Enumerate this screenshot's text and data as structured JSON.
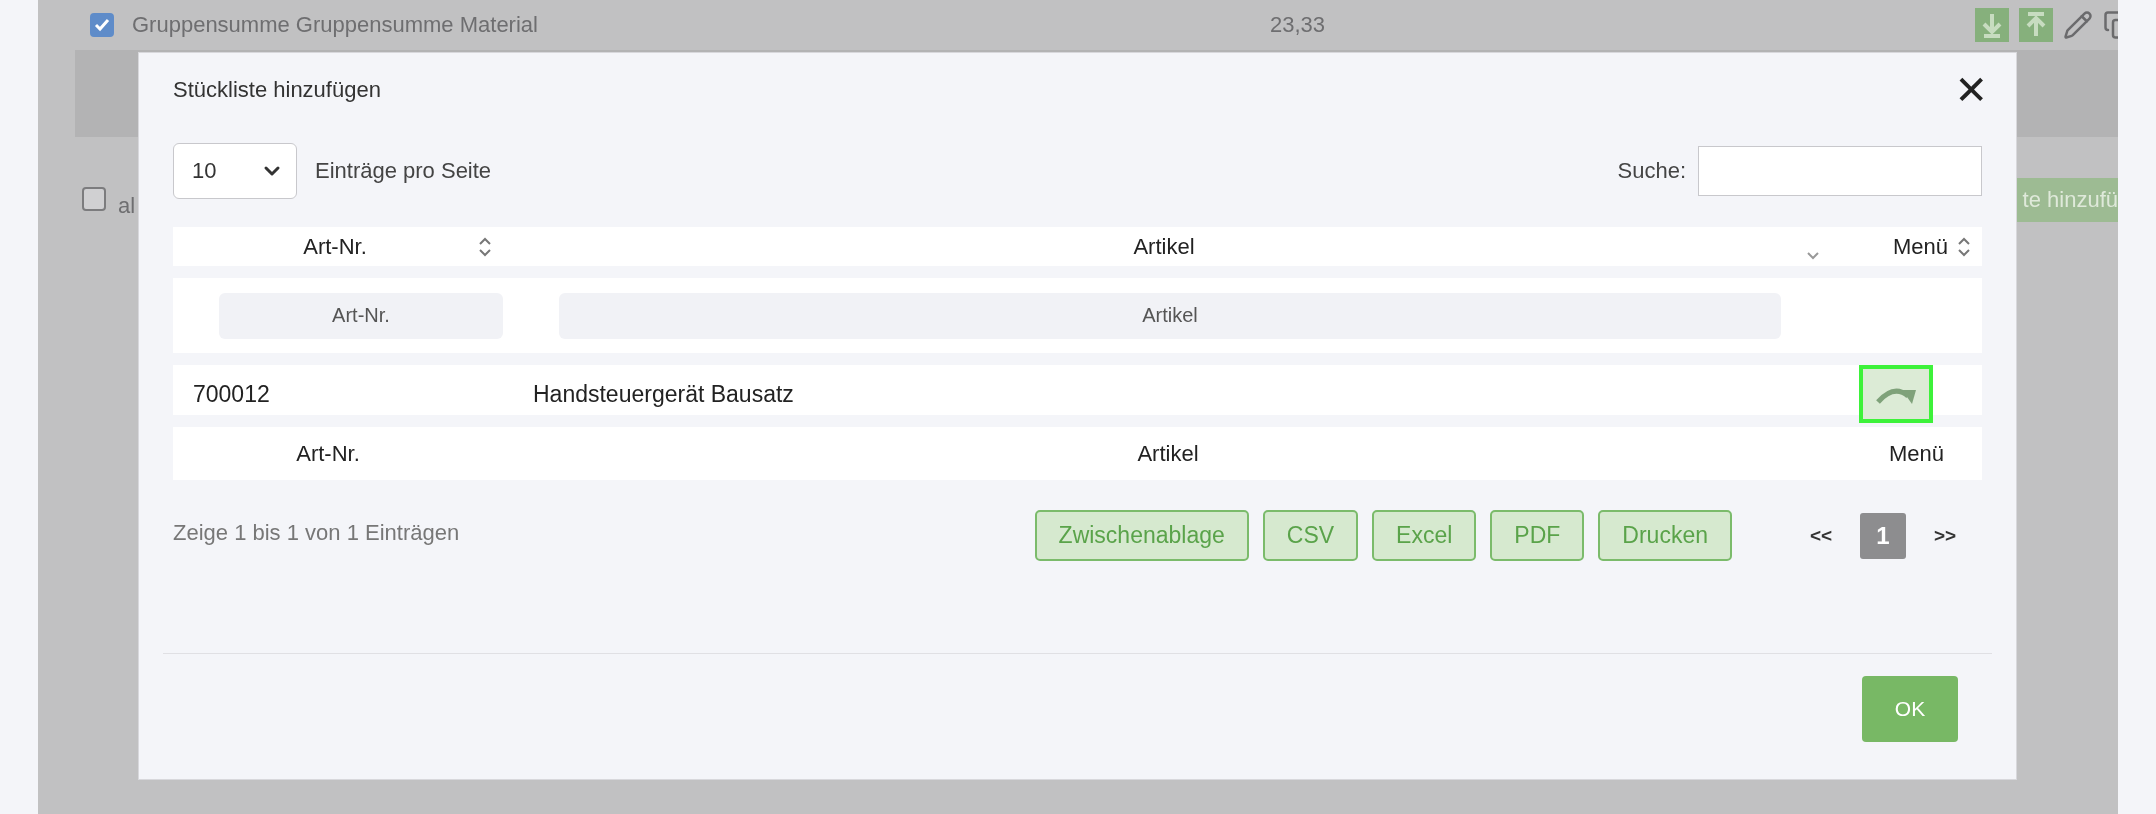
{
  "background": {
    "row": {
      "checked": true,
      "text": "Gruppensumme Gruppensumme Material",
      "amount": "23,33"
    },
    "select_all": {
      "label": "al",
      "checked": false
    },
    "button": "te hinzufü"
  },
  "dialog": {
    "title": "Stückliste hinzufügen",
    "close": "✕",
    "page_size": "10",
    "page_size_label": "Einträge pro Seite",
    "search_label": "Suche:",
    "columns": [
      {
        "label": "Art-Nr.",
        "sorted": false
      },
      {
        "label": "Artikel",
        "sorted": true
      },
      {
        "label": "Menü",
        "sorted": false
      }
    ],
    "filters": [
      {
        "placeholder": "Art-Nr."
      },
      {
        "placeholder": "Artikel"
      }
    ],
    "rows": [
      {
        "art_nr": "700012",
        "artikel": "Handsteuergerät Bausatz",
        "focused": true
      }
    ],
    "footer": [
      "Art-Nr.",
      "Artikel",
      "Menü"
    ],
    "info": "Zeige 1 bis 1 von 1 Einträgen",
    "export_buttons": [
      "Zwischenablage",
      "CSV",
      "Excel",
      "PDF",
      "Drucken"
    ],
    "pagination": [
      {
        "label": "<<",
        "selected": false
      },
      {
        "label": "1",
        "selected": true
      },
      {
        "label": ">>",
        "selected": false
      }
    ],
    "ok": "OK"
  }
}
